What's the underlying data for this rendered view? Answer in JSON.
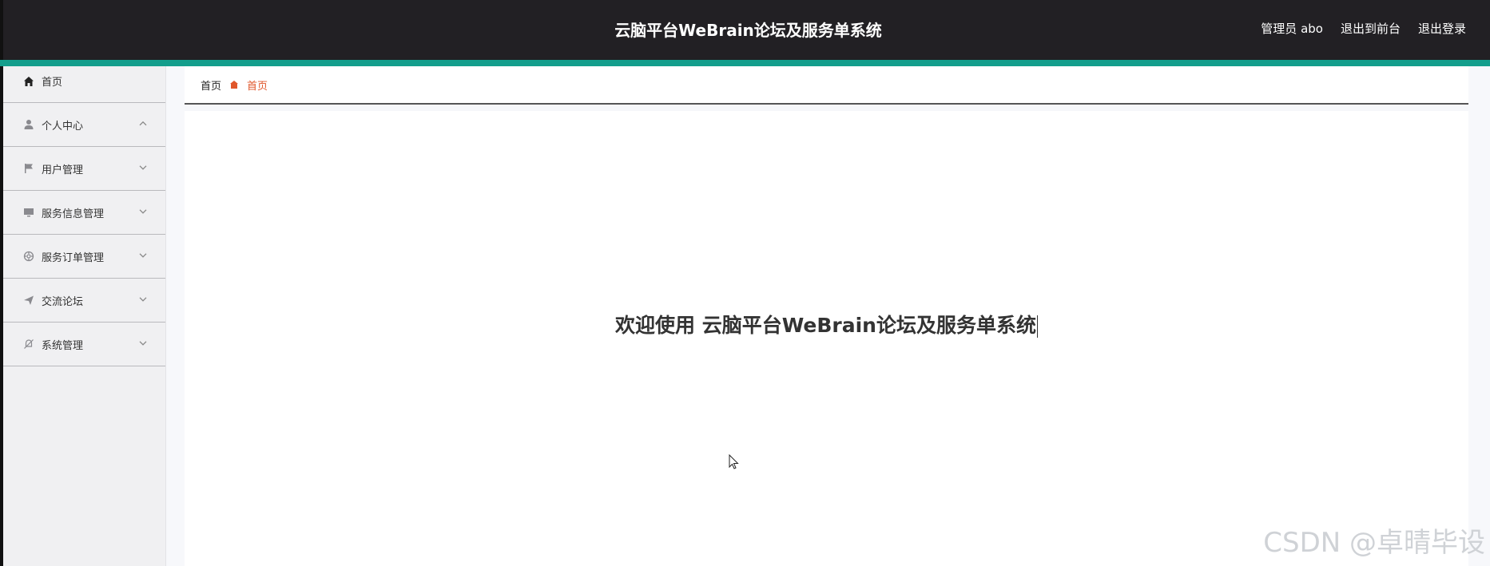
{
  "header": {
    "title": "云脑平台WeBrain论坛及服务单系统",
    "user_label": "管理员 abo",
    "front_label": "退出到前台",
    "logout_label": "退出登录"
  },
  "sidebar": {
    "items": [
      {
        "label": "首页",
        "icon": "home-icon"
      },
      {
        "label": "个人中心",
        "icon": "user-icon",
        "expanded": true
      },
      {
        "label": "用户管理",
        "icon": "flag-icon"
      },
      {
        "label": "服务信息管理",
        "icon": "monitor-icon"
      },
      {
        "label": "服务订单管理",
        "icon": "target-icon"
      },
      {
        "label": "交流论坛",
        "icon": "send-icon"
      },
      {
        "label": "系统管理",
        "icon": "bell-off-icon"
      }
    ]
  },
  "breadcrumb": {
    "home": "首页",
    "current": "首页"
  },
  "main": {
    "welcome": "欢迎使用 云脑平台WeBrain论坛及服务单系统"
  },
  "watermark": "CSDN @卓晴毕设",
  "colors": {
    "header_bg": "#222024",
    "accent": "#139e8c",
    "breadcrumb_current": "#e0572b"
  }
}
